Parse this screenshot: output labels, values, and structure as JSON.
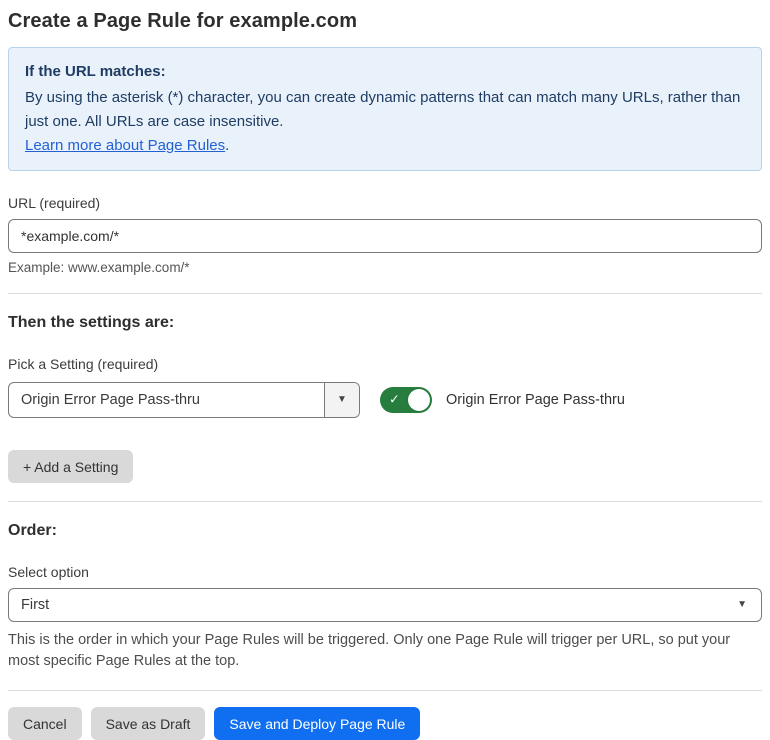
{
  "page": {
    "title": "Create a Page Rule for example.com"
  },
  "info_box": {
    "heading": "If the URL matches:",
    "body": "By using the asterisk (*) character, you can create dynamic patterns that can match many URLs, rather than just one. All URLs are case insensitive.",
    "link_label": "Learn more about Page Rules",
    "link_suffix": "."
  },
  "url_field": {
    "label": "URL (required)",
    "value": "*example.com/*",
    "helper": "Example: www.example.com/*"
  },
  "settings_section": {
    "heading": "Then the settings are:",
    "picker_label": "Pick a Setting (required)",
    "picker_value": "Origin Error Page Pass-thru",
    "toggle_state": "on",
    "toggle_label": "Origin Error Page Pass-thru",
    "add_setting_label": "+ Add a Setting"
  },
  "order_section": {
    "heading": "Order:",
    "select_label": "Select option",
    "select_value": "First",
    "helper": "This is the order in which your Page Rules will be triggered. Only one Page Rule will trigger per URL, so put your most specific Page Rules at the top."
  },
  "footer": {
    "cancel_label": "Cancel",
    "save_draft_label": "Save as Draft",
    "save_deploy_label": "Save and Deploy Page Rule"
  },
  "icons": {
    "chevron_down": "▼",
    "check": "✓"
  },
  "colors": {
    "accent_blue": "#106ef0",
    "toggle_green": "#267d3e",
    "info_bg": "#e9f1fb",
    "info_border": "#bad1ee",
    "info_text": "#1f3d63",
    "link_blue": "#2361d2"
  }
}
